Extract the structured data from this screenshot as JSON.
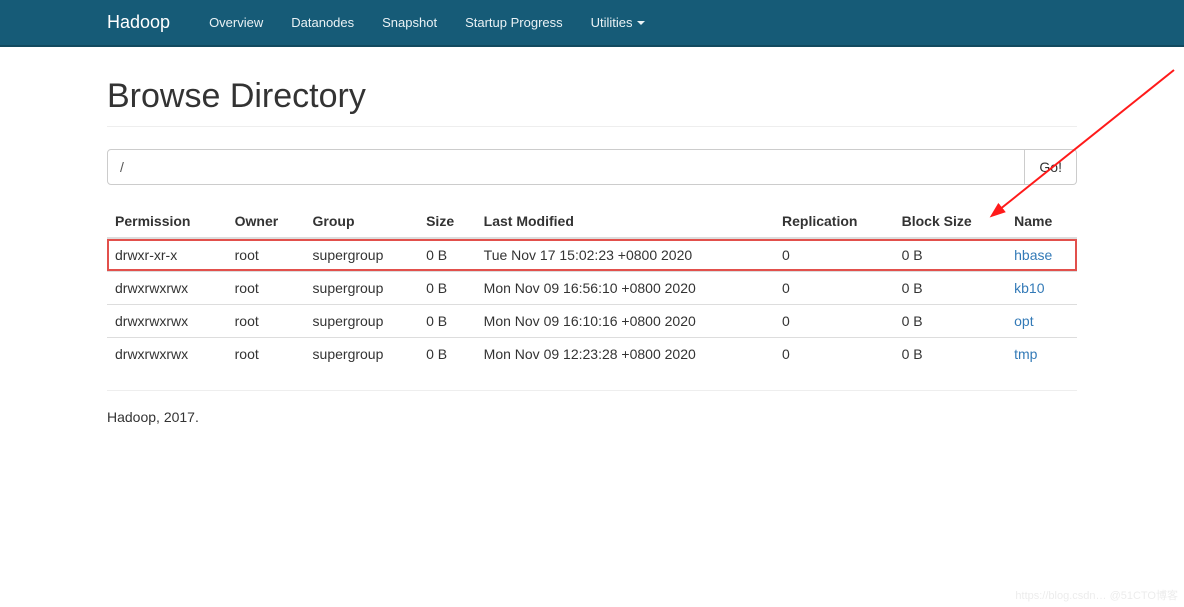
{
  "nav": {
    "brand": "Hadoop",
    "items": [
      "Overview",
      "Datanodes",
      "Snapshot",
      "Startup Progress",
      "Utilities"
    ]
  },
  "header": {
    "title": "Browse Directory"
  },
  "path": {
    "value": "/",
    "go_label": "Go!"
  },
  "table": {
    "headers": [
      "Permission",
      "Owner",
      "Group",
      "Size",
      "Last Modified",
      "Replication",
      "Block Size",
      "Name"
    ],
    "rows": [
      {
        "perm": "drwxr-xr-x",
        "owner": "root",
        "group": "supergroup",
        "size": "0 B",
        "modified": "Tue Nov 17 15:02:23 +0800 2020",
        "replication": "0",
        "block_size": "0 B",
        "name": "hbase",
        "highlight": true
      },
      {
        "perm": "drwxrwxrwx",
        "owner": "root",
        "group": "supergroup",
        "size": "0 B",
        "modified": "Mon Nov 09 16:56:10 +0800 2020",
        "replication": "0",
        "block_size": "0 B",
        "name": "kb10",
        "highlight": false
      },
      {
        "perm": "drwxrwxrwx",
        "owner": "root",
        "group": "supergroup",
        "size": "0 B",
        "modified": "Mon Nov 09 16:10:16 +0800 2020",
        "replication": "0",
        "block_size": "0 B",
        "name": "opt",
        "highlight": false
      },
      {
        "perm": "drwxrwxrwx",
        "owner": "root",
        "group": "supergroup",
        "size": "0 B",
        "modified": "Mon Nov 09 12:23:28 +0800 2020",
        "replication": "0",
        "block_size": "0 B",
        "name": "tmp",
        "highlight": false
      }
    ]
  },
  "footer": {
    "text": "Hadoop, 2017."
  },
  "watermark": "https://blog.csdn… @51CTO博客",
  "arrow_color": "#ff1a1a"
}
